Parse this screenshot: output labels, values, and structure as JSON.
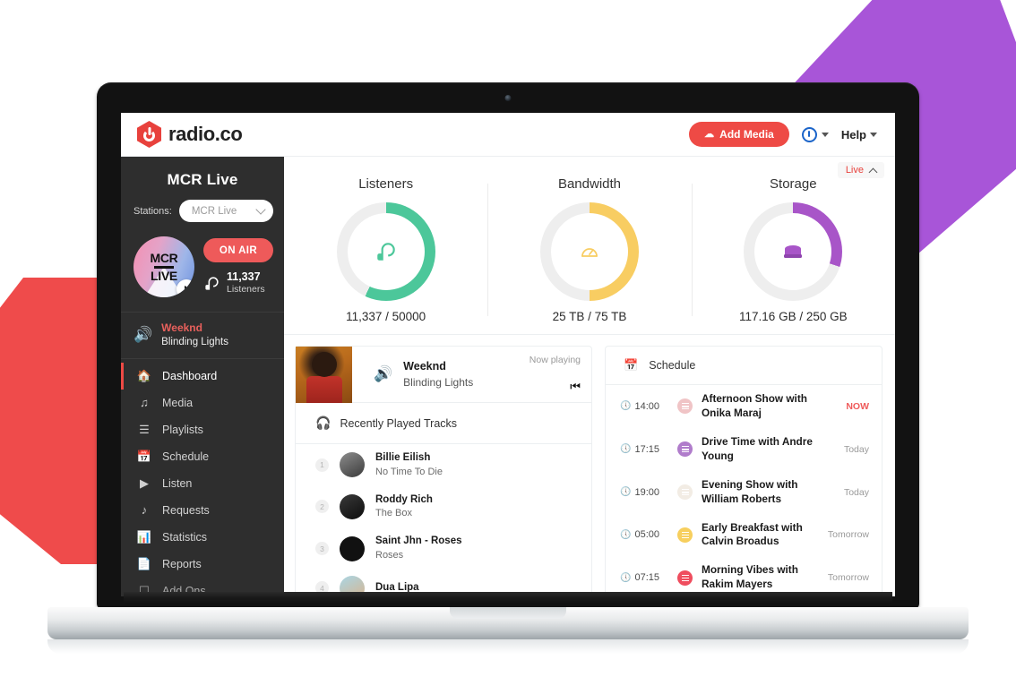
{
  "brand": {
    "name": "radio.co",
    "logo_icon": "radio-power-hex-icon",
    "color": "#e8413c"
  },
  "topbar": {
    "add_media_label": "Add Media",
    "add_media_icon": "cloud-upload-icon",
    "power_icon": "power-circle-icon",
    "help_label": "Help",
    "caret_icon": "caret-down-icon"
  },
  "live_badge": {
    "label": "Live",
    "icon": "chevron-up-icon"
  },
  "sidebar": {
    "station_title": "MCR Live",
    "stations_label": "Stations:",
    "station_selected": "MCR Live",
    "station_caret_icon": "chevron-down-icon",
    "artwork_lines": [
      "MCR",
      "LIVE"
    ],
    "play_icon": "play-icon",
    "on_air_label": "ON AIR",
    "listeners_count": "11,337",
    "listeners_label": "Listeners",
    "listeners_icon": "head-headphones-icon",
    "now_playing": {
      "icon": "speaker-icon",
      "artist": "Weeknd",
      "track": "Blinding Lights"
    },
    "nav": [
      {
        "label": "Dashboard",
        "icon": "home-icon",
        "active": true
      },
      {
        "label": "Media",
        "icon": "music-note-icon",
        "active": false
      },
      {
        "label": "Playlists",
        "icon": "list-lines-icon",
        "active": false
      },
      {
        "label": "Schedule",
        "icon": "calendar-icon",
        "active": false
      },
      {
        "label": "Listen",
        "icon": "play-icon",
        "active": false
      },
      {
        "label": "Requests",
        "icon": "music-note-plus-icon",
        "active": false
      },
      {
        "label": "Statistics",
        "icon": "bar-chart-icon",
        "active": false
      },
      {
        "label": "Reports",
        "icon": "document-icon",
        "active": false
      },
      {
        "label": "Add Ons",
        "icon": "plugin-icon",
        "active": false
      }
    ]
  },
  "stats": [
    {
      "title": "Listeners",
      "value_text": "11,337 / 50000",
      "icon": "head-headphones-icon",
      "color": "#4cc79a",
      "track_color": "#eeeeee",
      "percent": 57
    },
    {
      "title": "Bandwidth",
      "value_text": "25 TB / 75 TB",
      "icon": "speedometer-icon",
      "color": "#f8cd62",
      "track_color": "#eeeeee",
      "percent": 50
    },
    {
      "title": "Storage",
      "value_text": "117.16 GB / 250 GB",
      "icon": "database-icon",
      "color": "#a855c8",
      "track_color": "#eeeeee",
      "percent": 30
    }
  ],
  "now_playing_panel": {
    "status_label": "Now playing",
    "artist": "Weeknd",
    "track": "Blinding Lights",
    "speaker_icon": "speaker-icon",
    "skip_icon": "skip-next-icon",
    "cover_alt": "weeknd-album-art"
  },
  "recently_played": {
    "header": "Recently Played Tracks",
    "header_icon": "headphones-icon",
    "tracks": [
      {
        "num": "1",
        "artist": "Billie Eilish",
        "song": "No Time To Die",
        "avatar_color": "#6e6e6e"
      },
      {
        "num": "2",
        "artist": "Roddy Rich",
        "song": "The Box",
        "avatar_color": "#1a1a1a"
      },
      {
        "num": "3",
        "artist": "Saint Jhn - Roses",
        "song": "Roses",
        "avatar_color": "#111111"
      },
      {
        "num": "4",
        "artist": "Dua Lipa",
        "song": "",
        "avatar_color": "#7fb7cf"
      }
    ]
  },
  "schedule": {
    "header": "Schedule",
    "header_icon": "calendar-icon",
    "clock_icon": "clock-icon",
    "rows": [
      {
        "time": "14:00",
        "name": "Afternoon Show with Onika Maraj",
        "when": "NOW",
        "is_now": true,
        "dot_color": "#f0c4c6"
      },
      {
        "time": "17:15",
        "name": "Drive Time with Andre Young",
        "when": "Today",
        "is_now": false,
        "dot_color": "#b07ccb"
      },
      {
        "time": "19:00",
        "name": "Evening Show with William Roberts",
        "when": "Today",
        "is_now": false,
        "dot_color": "#f2ece4"
      },
      {
        "time": "05:00",
        "name": "Early Breakfast with Calvin Broadus",
        "when": "Tomorrow",
        "is_now": false,
        "dot_color": "#f7cf5e"
      },
      {
        "time": "07:15",
        "name": "Morning Vibes with Rakim Mayers",
        "when": "Tomorrow",
        "is_now": false,
        "dot_color": "#ef4d5e"
      }
    ]
  },
  "decor": {
    "hex_purple": "#a855d8",
    "hex_red": "#ef4b4b"
  }
}
